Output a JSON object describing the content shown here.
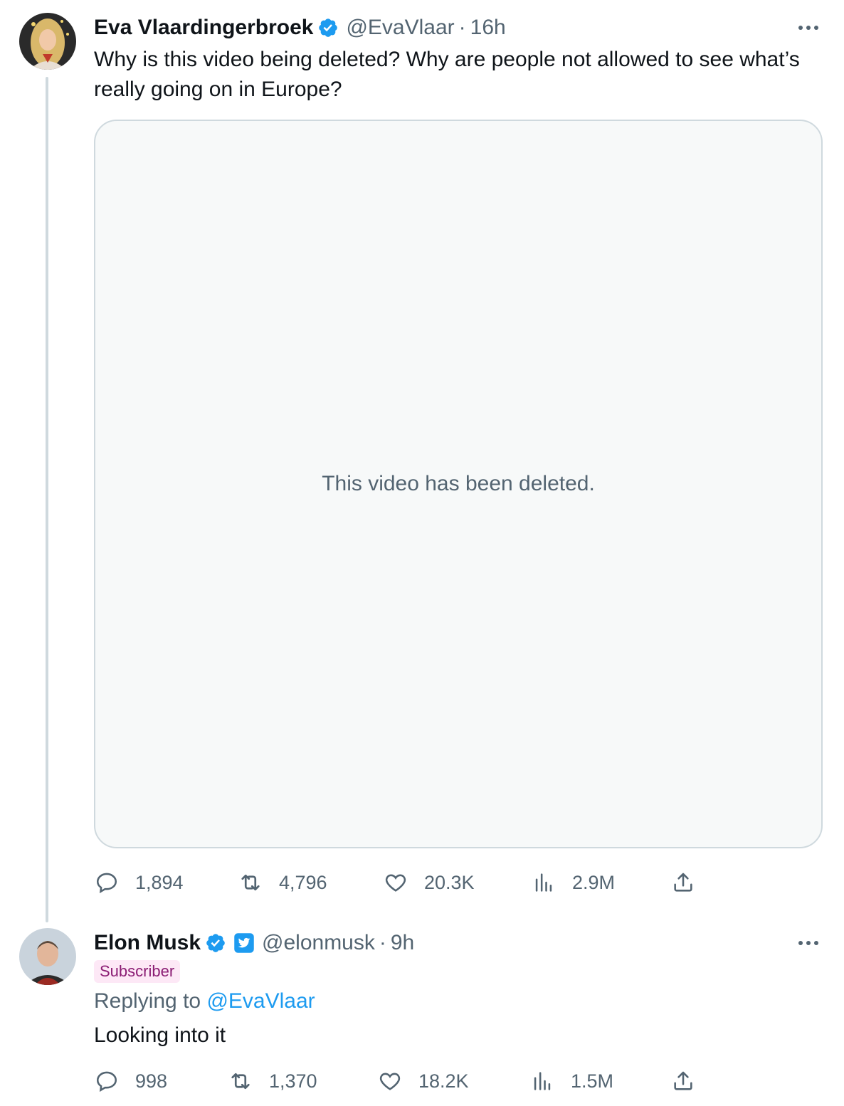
{
  "tweet1": {
    "name": "Eva Vlaardingerbroek",
    "handle": "@EvaVlaar",
    "separator": "·",
    "time": "16h",
    "text": "Why is this video being deleted? Why are people not allowed to see what’s really going on in Europe?",
    "media_message": "This video has been deleted.",
    "stats": {
      "replies": "1,894",
      "reposts": "4,796",
      "likes": "20.3K",
      "views": "2.9M"
    }
  },
  "tweet2": {
    "name": "Elon Musk",
    "handle": "@elonmusk",
    "separator": "·",
    "time": "9h",
    "badge": "Subscriber",
    "replying_prefix": "Replying to",
    "replying_handle": "@EvaVlaar",
    "text": "Looking into it",
    "stats": {
      "replies": "998",
      "reposts": "1,370",
      "likes": "18.2K",
      "views": "1.5M"
    }
  },
  "colors": {
    "verified": "#1d9bf0",
    "muted": "#536471",
    "border": "#cfd9de",
    "subscriber_bg": "#fde8f6",
    "subscriber_fg": "#8b1d74"
  }
}
